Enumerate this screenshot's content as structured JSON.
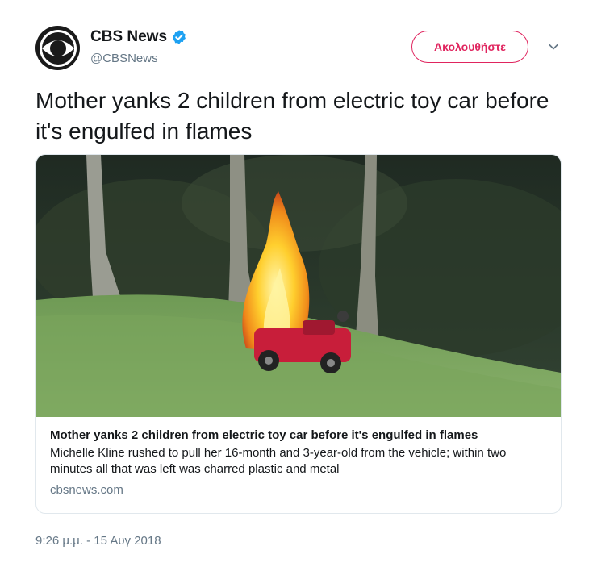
{
  "header": {
    "display_name": "CBS News",
    "handle": "@CBSNews",
    "follow_label": "Ακολουθήστε",
    "verified_icon": "verified-badge-icon",
    "accent_color": "#e0245e",
    "verified_color": "#1da1f2"
  },
  "tweet": {
    "text": "Mother yanks 2 children from electric toy car before it's engulfed in flames",
    "timestamp": "9:26 μ.μ. - 15 Αυγ 2018"
  },
  "card": {
    "image_description_icon": "photo-burning-toy-car",
    "title": "Mother yanks 2 children from electric toy car before it's engulfed in flames",
    "description": "Michelle Kline rushed to pull her 16-month and 3-year-old from the vehicle; within two minutes all that was left was charred plastic and metal",
    "domain": "cbsnews.com"
  }
}
